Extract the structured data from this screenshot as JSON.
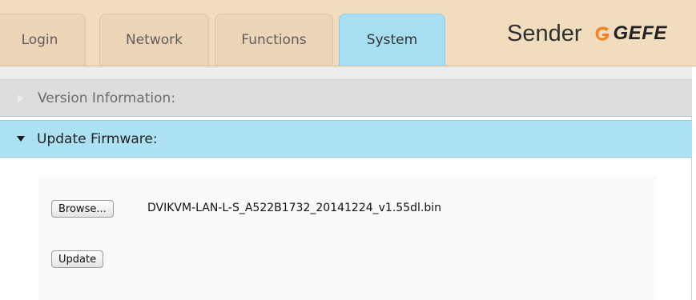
{
  "tabs": [
    {
      "label": "Login",
      "active": false
    },
    {
      "label": "Network",
      "active": false
    },
    {
      "label": "Functions",
      "active": false
    },
    {
      "label": "System",
      "active": true
    }
  ],
  "brand": {
    "title": "Sender",
    "logo_text": "GEFE"
  },
  "sections": {
    "version": {
      "label": "Version Information:",
      "expanded": false
    },
    "update": {
      "label": "Update Firmware:",
      "expanded": true
    }
  },
  "firmware": {
    "browse_label": "Browse...",
    "selected_file": "DVIKVM-LAN-L-S_A522B1732_20141224_v1.55dl.bin",
    "update_label": "Update"
  },
  "colors": {
    "header_bg": "#f1dcbd",
    "active_tab": "#a8def2",
    "expanded_section": "#ace0f4",
    "logo_orange": "#f58220"
  }
}
